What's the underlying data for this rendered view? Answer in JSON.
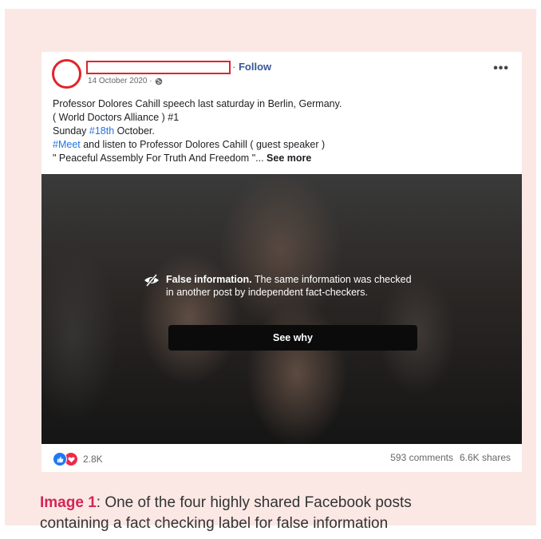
{
  "post": {
    "follow_label": "Follow",
    "follow_separator": "·",
    "date": "14 October 2020 ·",
    "more_label": "•••",
    "text": {
      "line1": "Professor Dolores Cahill speech last saturday in Berlin, Germany.",
      "line2": "( World Doctors Alliance ) #1",
      "line3_pre": "Sunday ",
      "line3_tag": "#18th",
      "line3_post": " October.",
      "line4_tag": "#Meet",
      "line4_post": " and listen to Professor Dolores Cahill ( guest speaker )",
      "line5": "\" Peaceful Assembly For Truth And Freedom \"... ",
      "see_more": "See more"
    }
  },
  "warning": {
    "title": "False information.",
    "body": " The same information was checked in another post by independent fact-checkers.",
    "button_label": "See why"
  },
  "stats": {
    "reactions_count": "2.8K",
    "comments": "593 comments",
    "shares": "6.6K shares"
  },
  "caption": {
    "label": "Image 1",
    "text_first": ": One of the four highly shared Facebook posts",
    "text_second": "containing a fact checking label for false information"
  },
  "colors": {
    "frame_bg": "#fbe8e4",
    "redaction": "#e0242b",
    "link": "#385898",
    "hashtag": "#2374e1",
    "caption_label": "#d62456"
  },
  "icons": {
    "globe": "globe-icon",
    "hidden": "eye-slash-icon",
    "like": "like-icon",
    "love": "love-icon"
  }
}
